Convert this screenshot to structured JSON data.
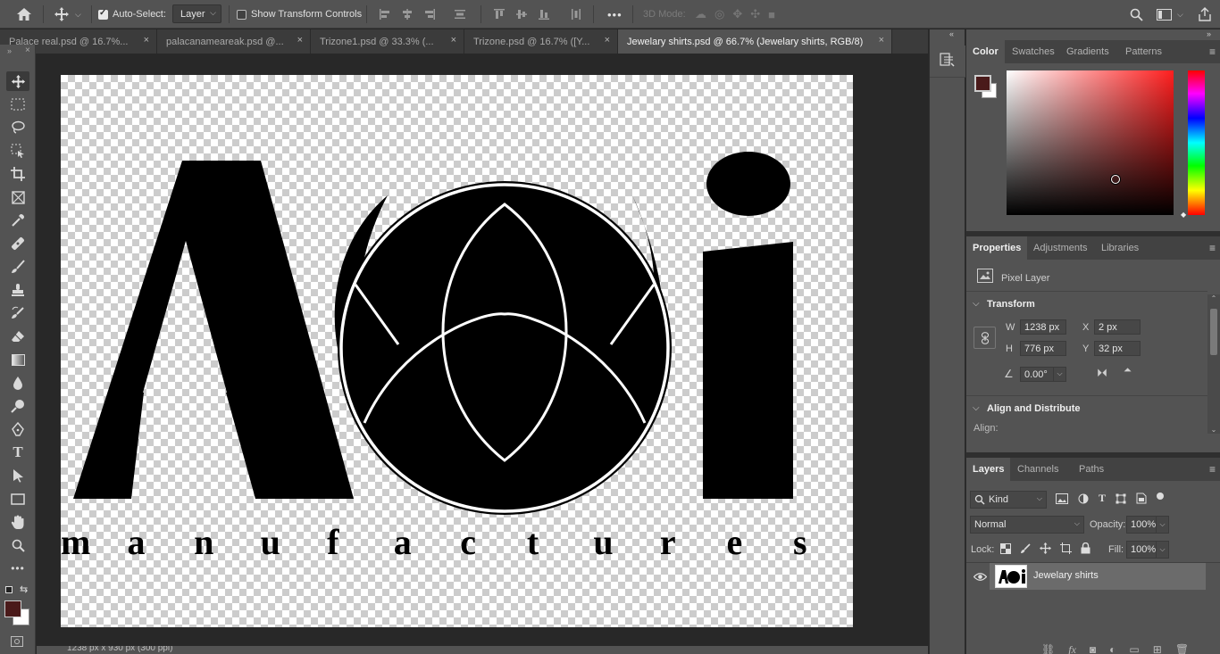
{
  "optbar": {
    "home_icon": "home-icon",
    "move_icon": "move-tool-icon",
    "auto_select_label": "Auto-Select:",
    "auto_select_checked": true,
    "auto_select_target": "Layer",
    "show_transform_label": "Show Transform Controls",
    "show_transform_checked": false,
    "more_label": "•••",
    "mode_3d_label": "3D Mode:"
  },
  "tabs": [
    {
      "label": "Palace real.psd @ 16.7%...",
      "active": false
    },
    {
      "label": "palacanameareak.psd @...",
      "active": false
    },
    {
      "label": "Trizone1.psd @ 33.3% (...",
      "active": false
    },
    {
      "label": "Trizone.psd @ 16.7% ([Y...",
      "active": false
    },
    {
      "label": "Jewelary shirts.psd @ 66.7% (Jewelary shirts, RGB/8)",
      "active": true
    }
  ],
  "tab_close": "×",
  "colors": {
    "foreground": "#4a1a1a",
    "background": "#ffffff"
  },
  "color_panel": {
    "tabs": [
      "Color",
      "Swatches",
      "Gradients",
      "Patterns"
    ],
    "hue": "#ff1f1f"
  },
  "properties": {
    "tabs": [
      "Properties",
      "Adjustments",
      "Libraries"
    ],
    "layer_type": "Pixel Layer",
    "transform_title": "Transform",
    "w_label": "W",
    "w_value": "1238 px",
    "h_label": "H",
    "h_value": "776 px",
    "x_label": "X",
    "x_value": "2 px",
    "y_label": "Y",
    "y_value": "32 px",
    "angle_value": "0.00°",
    "align_title": "Align and Distribute",
    "align_label": "Align:"
  },
  "layers": {
    "tabs": [
      "Layers",
      "Channels",
      "Paths"
    ],
    "filter_kind": "Kind",
    "blend_mode": "Normal",
    "opacity_label": "Opacity:",
    "opacity_value": "100%",
    "lock_label": "Lock:",
    "fill_label": "Fill:",
    "fill_value": "100%",
    "items": [
      {
        "name": "Jewelary shirts",
        "visible": true,
        "selected": true
      }
    ]
  },
  "artwork": {
    "letter_a": "A",
    "letter_i": "i",
    "subtitle_letters": [
      "m",
      "a",
      "n",
      "u",
      "f",
      "a",
      "c",
      "t",
      "u",
      "r",
      "e",
      "s"
    ]
  },
  "status": {
    "doc_size": "1238 px x 930 px (300 ppi)"
  }
}
